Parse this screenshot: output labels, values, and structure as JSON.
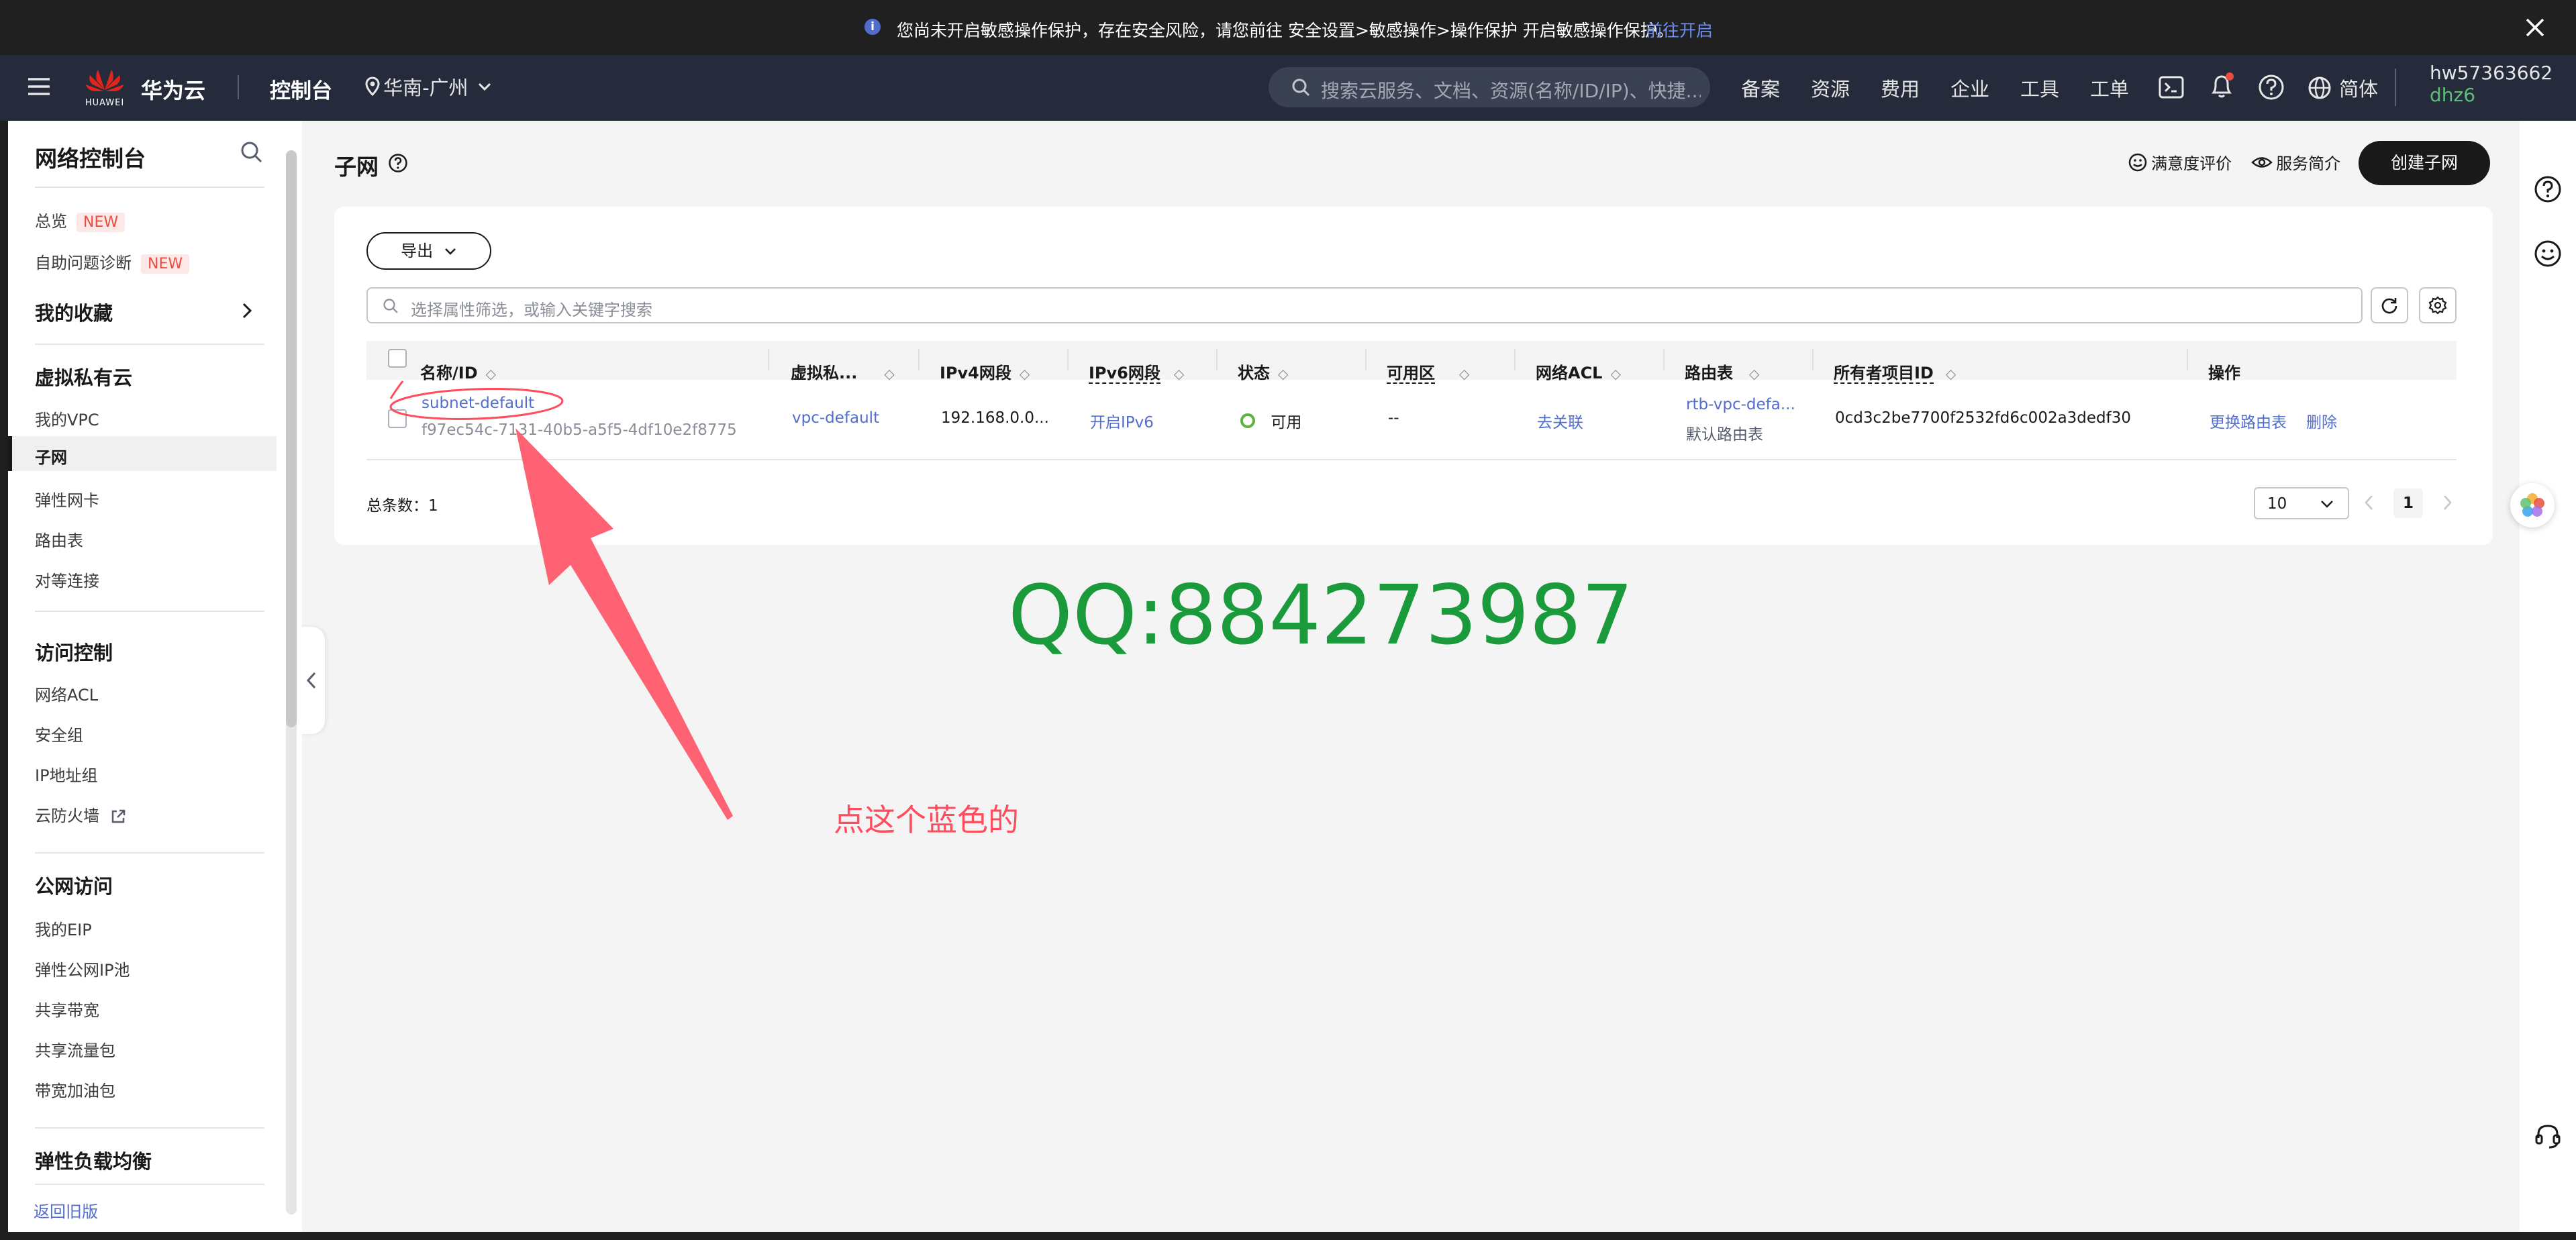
{
  "notice": {
    "text": "您尚未开启敏感操作保护，存在安全风险，请您前往 安全设置>敏感操作>操作保护 开启敏感操作保护。",
    "link": "前往开启",
    "info_icon": "info-icon",
    "close_icon": "close-icon"
  },
  "topnav": {
    "logo_text": "HUAWEI",
    "brand": "华为云",
    "console": "控制台",
    "region": "华南-广州",
    "search_placeholder": "搜索云服务、文档、资源(名称/ID/IP)、快捷...",
    "links": [
      "备案",
      "资源",
      "费用",
      "企业",
      "工具",
      "工单"
    ],
    "lang": "简体",
    "username": "hw57363662",
    "subuser": "dhz6"
  },
  "sidebar": {
    "title": "网络控制台",
    "items_top": [
      {
        "label": "总览",
        "badge": "NEW"
      },
      {
        "label": "自助问题诊断",
        "badge": "NEW"
      }
    ],
    "favorites": "我的收藏",
    "section_vpc": "虚拟私有云",
    "vpc_items": [
      "我的VPC",
      "子网",
      "弹性网卡",
      "路由表",
      "对等连接"
    ],
    "section_access": "访问控制",
    "access_items": [
      "网络ACL",
      "安全组",
      "IP地址组",
      "云防火墙"
    ],
    "section_public": "公网访问",
    "public_items": [
      "我的EIP",
      "弹性公网IP池",
      "共享带宽",
      "共享流量包",
      "带宽加油包"
    ],
    "section_elb": "弹性负载均衡",
    "back_old": "返回旧版"
  },
  "page": {
    "title": "子网",
    "satisfaction": "满意度评价",
    "intro": "服务简介",
    "create_button": "创建子网",
    "export_button": "导出",
    "filter_placeholder": "选择属性筛选，或输入关键字搜索"
  },
  "table": {
    "headers": [
      "名称/ID",
      "虚拟私...",
      "IPv4网段",
      "IPv6网段",
      "状态",
      "可用区",
      "网络ACL",
      "路由表",
      "所有者项目ID",
      "操作"
    ],
    "rows": [
      {
        "name": "subnet-default",
        "id": "f97ec54c-7131-40b5-a5f5-4df10e2f8775",
        "vpc": "vpc-default",
        "ipv4": "192.168.0.0...",
        "ipv6": "开启IPv6",
        "status": "可用",
        "az": "--",
        "acl": "去关联",
        "route_table": "rtb-vpc-defa...",
        "route_table_note": "默认路由表",
        "owner_project": "0cd3c2be7700f2532fd6c002a3dedf30",
        "action_change_route": "更换路由表",
        "action_delete": "删除"
      }
    ],
    "total_label": "总条数：",
    "total": "1",
    "page_size": "10",
    "current_page": "1"
  },
  "annotation": {
    "qq": "QQ:884273987",
    "hint": "点这个蓝色的",
    "arrow_color": "#ff4d5e",
    "qq_color": "#1a9a3a"
  },
  "colors": {
    "accent": "#526ecc",
    "nav_bg": "#252b3a",
    "status_ok": "#5fb33c",
    "primary_button": "#191919"
  }
}
